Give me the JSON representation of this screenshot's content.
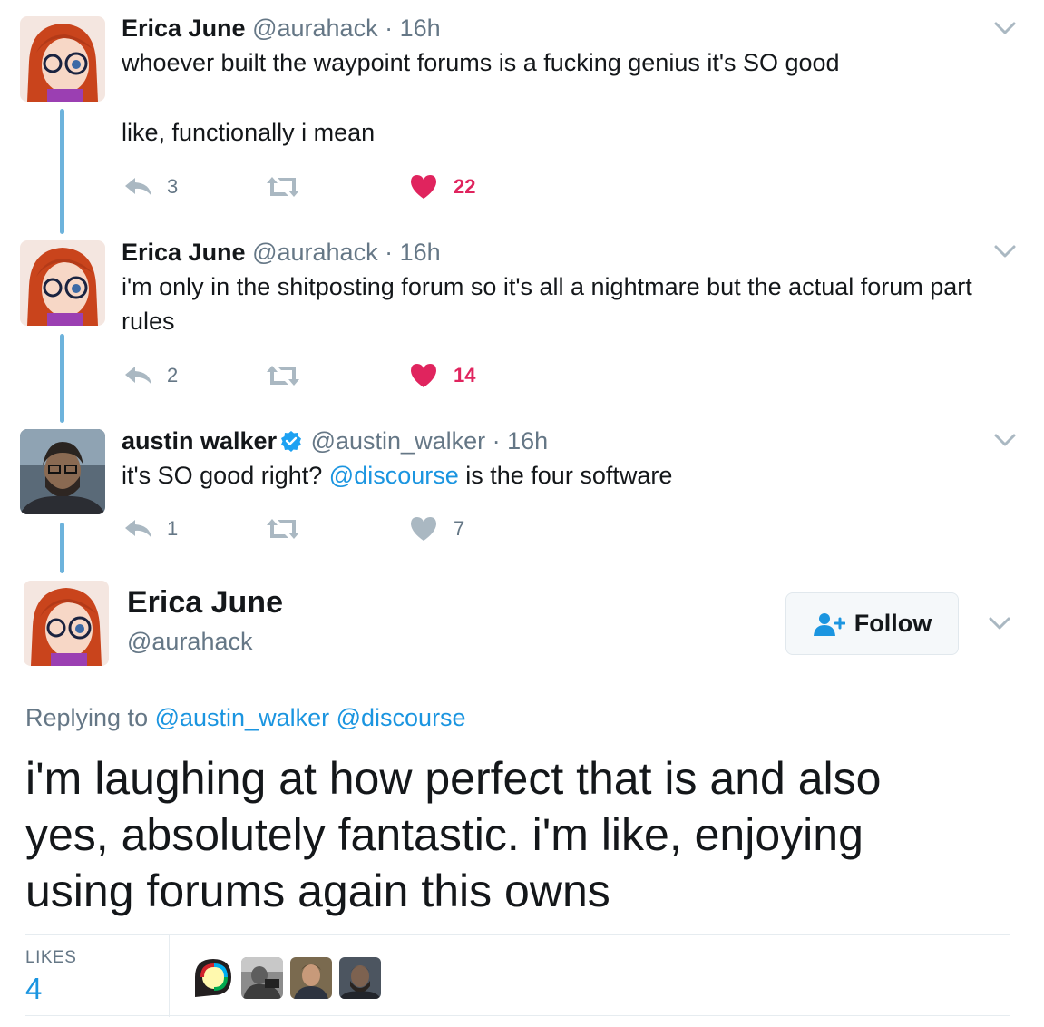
{
  "tweets": [
    {
      "name": "Erica June",
      "handle": "@aurahack",
      "separator": "·",
      "time": "16h",
      "text_line1": "whoever built the waypoint forums is a fucking genius it's SO good",
      "text_line2": "like, functionally i mean",
      "replies": "3",
      "likes": "22",
      "liked": true
    },
    {
      "name": "Erica June",
      "handle": "@aurahack",
      "separator": "·",
      "time": "16h",
      "text_line1": "i'm only in the shitposting forum so it's all a nightmare but the actual forum part",
      "text_line2": "rules",
      "replies": "2",
      "likes": "14",
      "liked": true
    },
    {
      "name": "austin walker",
      "handle": "@austin_walker",
      "separator": "·",
      "time": "16h",
      "text_before": "it's SO good right? ",
      "text_mention": "@discourse",
      "text_after": " is the four software",
      "replies": "1",
      "likes": "7",
      "liked": false,
      "verified": true
    }
  ],
  "main_tweet": {
    "name": "Erica June",
    "handle": "@aurahack",
    "follow_label": "Follow",
    "replying_prefix": "Replying to ",
    "replying_mention1": "@austin_walker",
    "replying_mention2": "@discourse",
    "text_line1": "i'm laughing at how perfect that is and also",
    "text_line2": "yes, absolutely fantastic. i'm like, enjoying",
    "text_line3": "using forums again this owns",
    "likes_label": "LIKES",
    "likes_count": "4"
  },
  "colors": {
    "link": "#1b95e0",
    "like": "#e0245e",
    "muted": "#657786",
    "thread": "#6db3dc"
  },
  "icons": [
    "reply-icon",
    "retweet-icon",
    "heart-icon",
    "chevron-down-icon",
    "verified-badge-icon",
    "follow-person-icon"
  ]
}
